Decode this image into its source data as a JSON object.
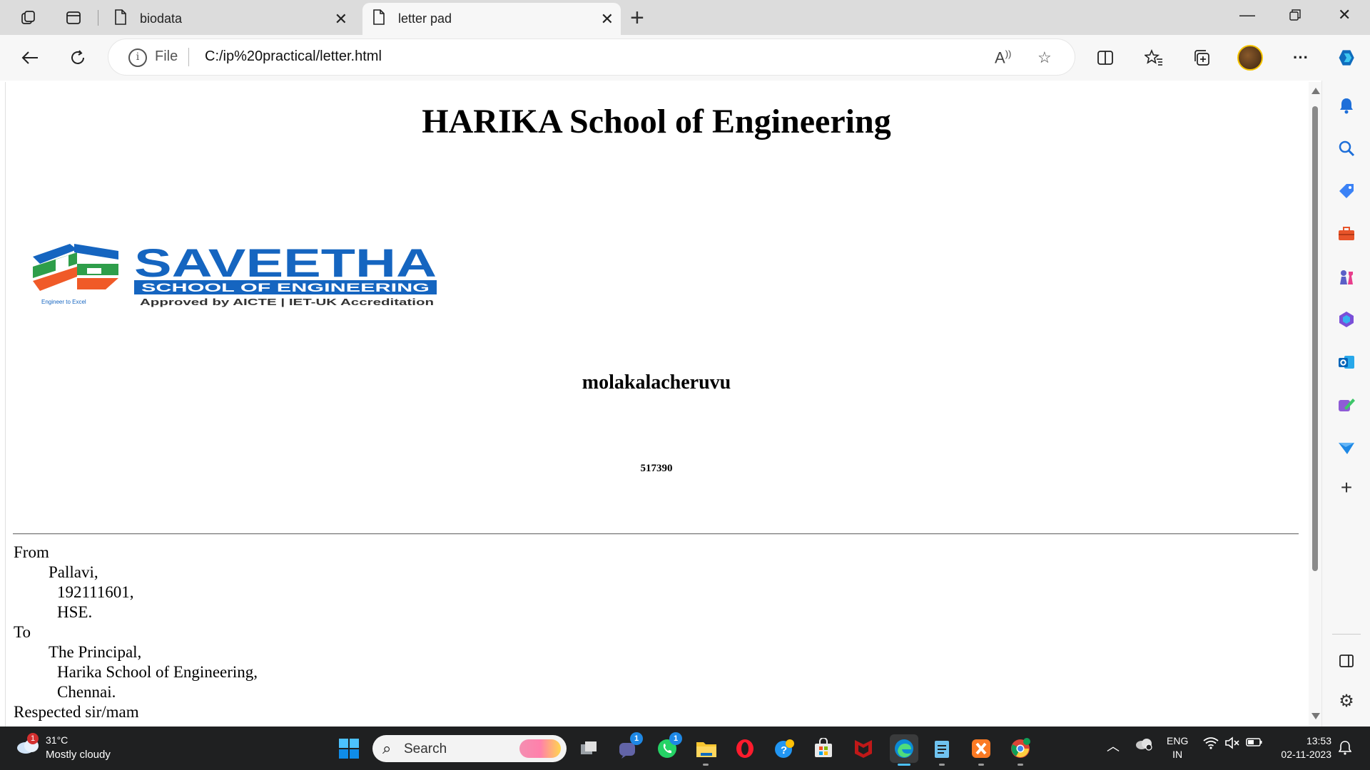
{
  "browser": {
    "tabs": [
      {
        "label": "biodata",
        "active": false
      },
      {
        "label": "letter pad",
        "active": true
      }
    ],
    "address": {
      "scheme_label": "File",
      "url": "C:/ip%20practical/letter.html"
    }
  },
  "page": {
    "heading": "HARIKA School of Engineering",
    "logo": {
      "name": "SAVEETHA",
      "subtitle": "SCHOOL OF ENGINEERING",
      "accreditation": "Approved by AICTE | IET-UK Accreditation",
      "tagline": "Engineer to Excel"
    },
    "city": "molakalacheruvu",
    "pincode": "517390",
    "letter": {
      "from_label": "From",
      "from_lines": [
        "Pallavi,",
        "192111601,",
        "HSE."
      ],
      "to_label": "To",
      "to_lines": [
        "The Principal,",
        "Harika School of Engineering,",
        "Chennai."
      ],
      "salutation": "Respected sir/mam"
    }
  },
  "taskbar": {
    "weather": {
      "temp": "31°C",
      "desc": "Mostly cloudy",
      "badge": "1"
    },
    "search_placeholder": "Search",
    "teams_badge": "1",
    "whatsapp_badge": "1",
    "language": {
      "line1": "ENG",
      "line2": "IN"
    },
    "clock": {
      "time": "13:53",
      "date": "02-11-2023"
    }
  },
  "colors": {
    "saveetha_blue": "#1565c0",
    "saveetha_orange": "#f05a28",
    "saveetha_green": "#2e9e4a",
    "edge_accent": "#0f6cbd"
  }
}
